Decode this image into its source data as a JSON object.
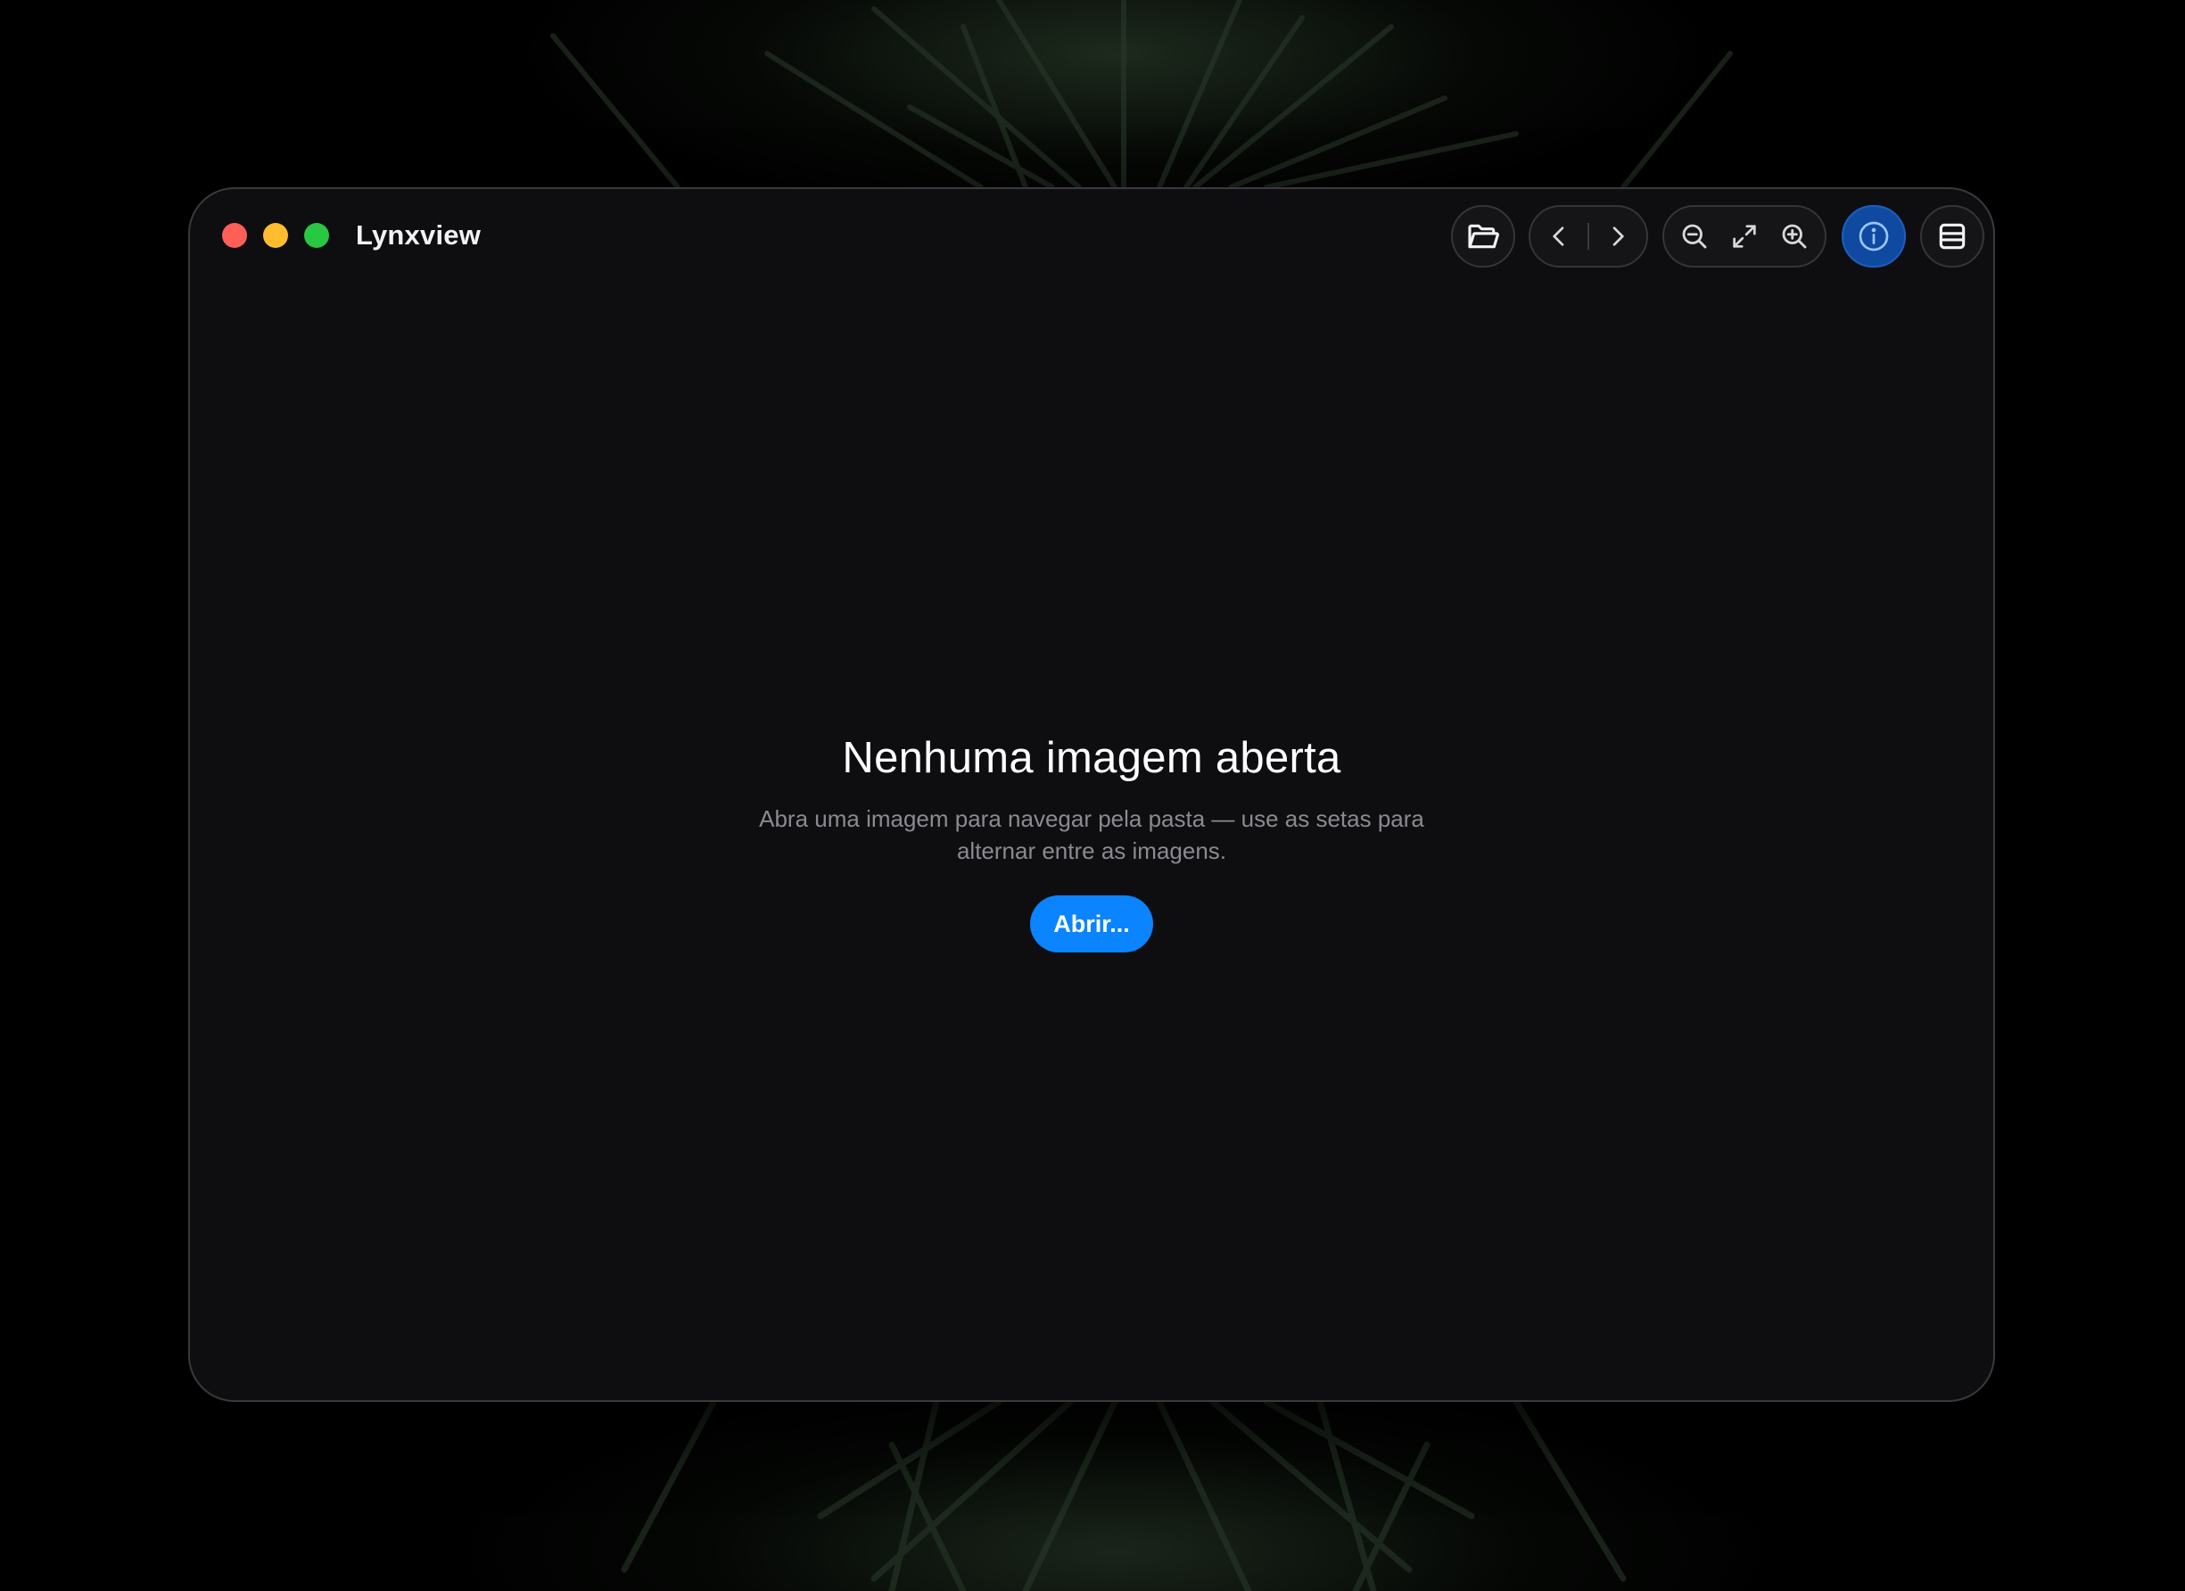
{
  "app": {
    "title": "Lynxview"
  },
  "window_controls": {
    "close_color": "#ff5f57",
    "minimize_color": "#febc2e",
    "maximize_color": "#28c840"
  },
  "toolbar": {
    "open_icon": "folder-open-icon",
    "prev_icon": "chevron-left-icon",
    "next_icon": "chevron-right-icon",
    "zoom_out_icon": "zoom-out-icon",
    "fit_icon": "expand-icon",
    "zoom_in_icon": "zoom-in-icon",
    "info_icon": "info-icon",
    "info_active": true,
    "panel_icon": "panel-icon"
  },
  "empty_state": {
    "title": "Nenhuma imagem aberta",
    "description": "Abra uma imagem para navegar pela pasta — use as setas para alternar entre as imagens.",
    "open_button_label": "Abrir..."
  },
  "colors": {
    "accent": "#0a84ff",
    "window_bg": "#0e0e11",
    "info_active_bg": "#0f4aa0"
  }
}
